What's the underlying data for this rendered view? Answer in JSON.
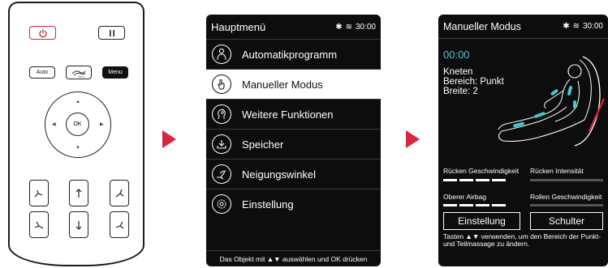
{
  "remote": {
    "power_icon": "power-icon",
    "pause_icon": "pause-icon",
    "auto_label": "Auto",
    "zero_label": "Zero",
    "menu_label": "Menu",
    "ok_label": "OK",
    "position_buttons": [
      "recline-up-icon",
      "legrest-up-icon",
      "backrest-up-icon",
      "recline-down-icon",
      "legrest-down-icon",
      "backrest-down-icon"
    ]
  },
  "main_menu": {
    "title": "Hauptmenü",
    "time": "30:00",
    "items": [
      {
        "label": "Automatikprogramm",
        "icon": "person-icon"
      },
      {
        "label": "Manueller Modus",
        "icon": "hand-icon"
      },
      {
        "label": "Weitere Funktionen",
        "icon": "head-icon"
      },
      {
        "label": "Speicher",
        "icon": "download-icon"
      },
      {
        "label": "Neigungswinkel",
        "icon": "recline-icon"
      },
      {
        "label": "Einstellung",
        "icon": "gear-icon"
      }
    ],
    "selected_index": 1,
    "footer": "Das Objekt mit ▲▼ auswählen und OK drücken"
  },
  "manual_mode": {
    "title": "Manueller Modus",
    "time": "30:00",
    "timer": "00:00",
    "info_lines": [
      "Kneten",
      "Bereich: Punkt",
      "Breite: 2"
    ],
    "labels": {
      "back_speed": "Rücken Geschwindigkeit",
      "back_intensity": "Rücken Intensität",
      "upper_airbag": "Oberer Airbag",
      "roller_speed": "Rollen Geschwindigkeit"
    },
    "buttons": [
      "Einstellung",
      "Schulter"
    ],
    "footer": "Tasten ▲▼ verwenden, um den Bereich der Punkt- und Teilmassage zu ändern."
  },
  "colors": {
    "accent_red": "#d7263d",
    "cyan": "#47c6d6",
    "screen_bg": "#0d0d0d"
  }
}
